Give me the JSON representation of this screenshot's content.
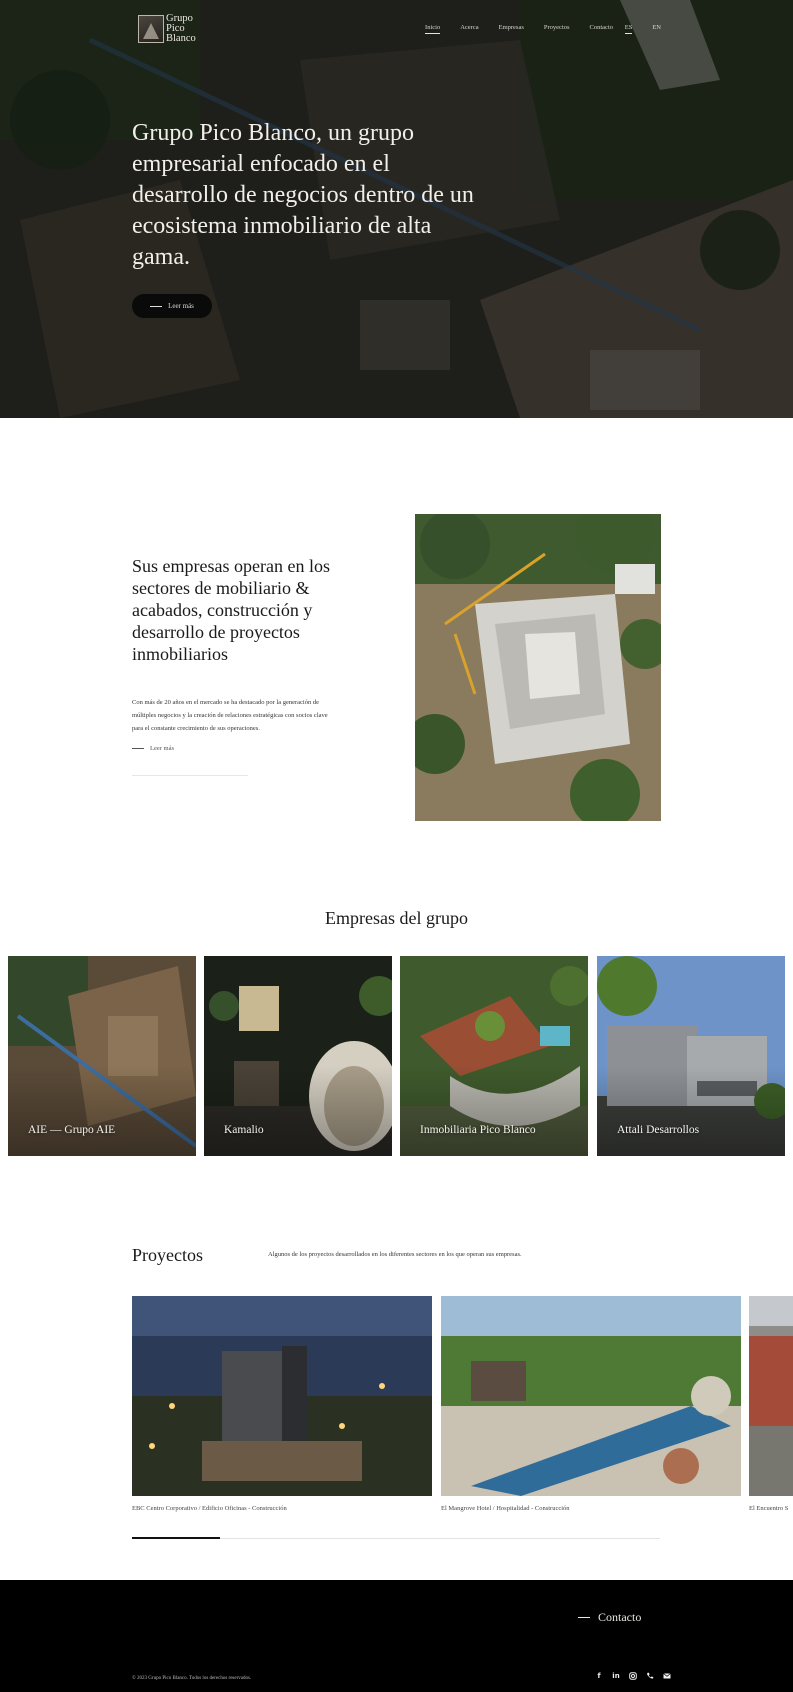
{
  "brand": {
    "logo_text": "Grupo Pico Blanco"
  },
  "nav": {
    "items": [
      {
        "label": "Inicio",
        "active": true
      },
      {
        "label": "Acerca"
      },
      {
        "label": "Empresas"
      },
      {
        "label": "Proyectos"
      },
      {
        "label": "Contacto"
      }
    ],
    "lang": [
      {
        "label": "ES",
        "active": true
      },
      {
        "label": "EN"
      }
    ]
  },
  "hero": {
    "title": "Grupo Pico Blanco, un grupo empresarial enfocado en el desarrollo de negocios dentro de un ecosistema inmobiliario de alta gama.",
    "button_label": "Leer más"
  },
  "about": {
    "title": "Sus empresas operan en los sectores de mobiliario & acabados, construcción y desarrollo de proyectos inmobiliarios",
    "body": "Con más de 20 años en el mercado se ha destacado por la generación de múltiples negocios y la creación de relaciones estratégicas con socios clave para el constante crecimiento de sus operaciones.",
    "more_label": "Leer más"
  },
  "companies": {
    "title": "Empresas del grupo",
    "items": [
      {
        "label": "AIE — Grupo AIE"
      },
      {
        "label": "Kamalio"
      },
      {
        "label": "Inmobiliaria Pico Blanco"
      },
      {
        "label": "Attali Desarrollos"
      }
    ]
  },
  "projects": {
    "title": "Proyectos",
    "description": "Algunos de los proyectos desarrollados en los diferentes sectores en los que operan sus empresas.",
    "items": [
      {
        "caption": "EBC Centro Corporativo / Edificio Oficinas - Construcción"
      },
      {
        "caption": "El Mangrove Hotel / Hospitalidad - Construcción"
      },
      {
        "caption": "El Encuentro S"
      }
    ]
  },
  "footer": {
    "contact_label": "Contacto",
    "copyright": "© 2023 Grupo Pico Blanco. Todos los derechos reservados.",
    "socials": [
      "facebook-icon",
      "linkedin-icon",
      "instagram-icon",
      "phone-icon",
      "mail-icon"
    ]
  }
}
